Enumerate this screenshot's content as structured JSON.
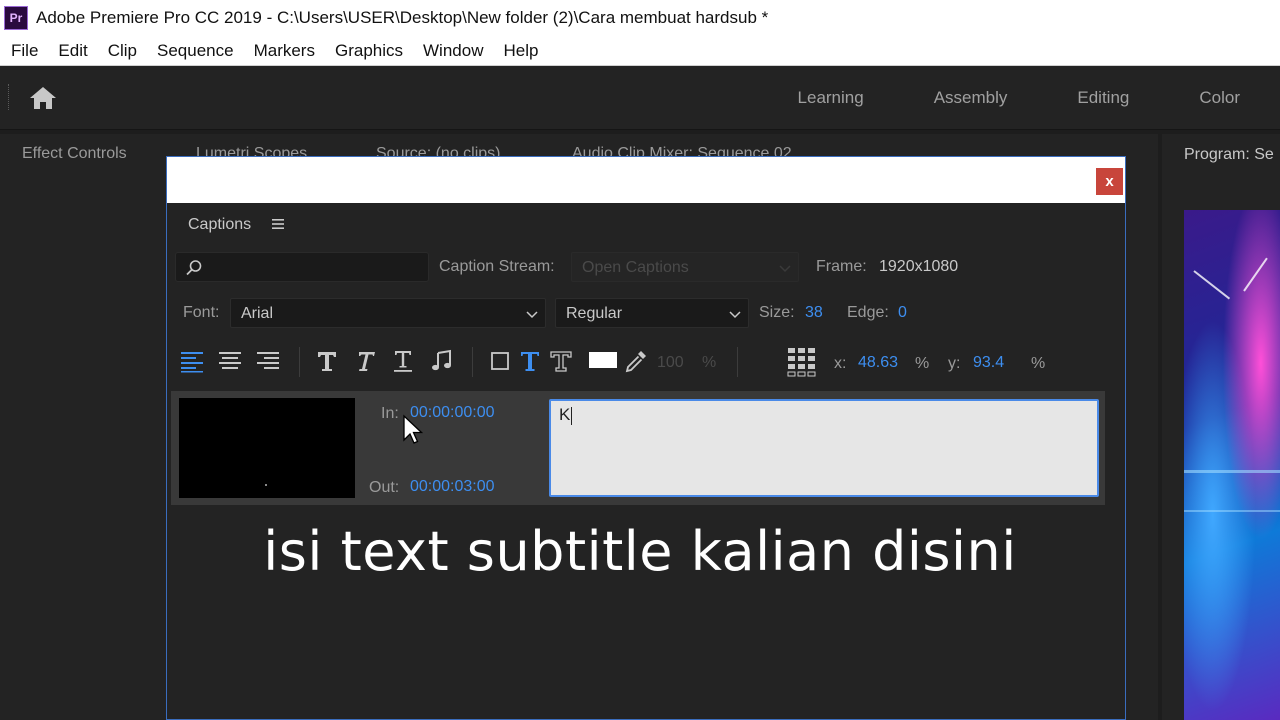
{
  "titlebar": {
    "logo": "Pr",
    "title": "Adobe Premiere Pro CC 2019 - C:\\Users\\USER\\Desktop\\New folder (2)\\Cara membuat hardsub *"
  },
  "menu": [
    "File",
    "Edit",
    "Clip",
    "Sequence",
    "Markers",
    "Graphics",
    "Window",
    "Help"
  ],
  "workspace": {
    "home_icon": "home-icon",
    "tabs": [
      "Learning",
      "Assembly",
      "Editing",
      "Color"
    ]
  },
  "panels": {
    "effect_controls": "Effect Controls",
    "lumetri": "Lumetri Scopes",
    "source": "Source: (no clips)",
    "audio_mixer": "Audio Clip Mixer: Sequence 02",
    "program": "Program: Se"
  },
  "dialog": {
    "close_label": "x",
    "captions_title": "Captions",
    "search_placeholder": "",
    "caption_stream_label": "Caption Stream:",
    "caption_stream_value": "Open Captions",
    "frame_label": "Frame:",
    "frame_value": "1920x1080",
    "font_label": "Font:",
    "font_value": "Arial",
    "style_value": "Regular",
    "size_label": "Size:",
    "size_value": "38",
    "edge_label": "Edge:",
    "edge_value": "0",
    "opacity_value": "100",
    "opacity_unit": "%",
    "x_label": "x:",
    "x_value": "48.63",
    "x_unit": "%",
    "y_label": "y:",
    "y_value": "93.4",
    "y_unit": "%",
    "in_label": "In:",
    "in_value": "00:00:00:00",
    "out_label": "Out:",
    "out_value": "00:00:03:00",
    "caption_text": "K"
  },
  "overlay": {
    "text": "isi text subtitle kalian disini"
  },
  "colors": {
    "accent": "#3d8ef0",
    "close": "#c8453b",
    "panel": "#232323"
  }
}
